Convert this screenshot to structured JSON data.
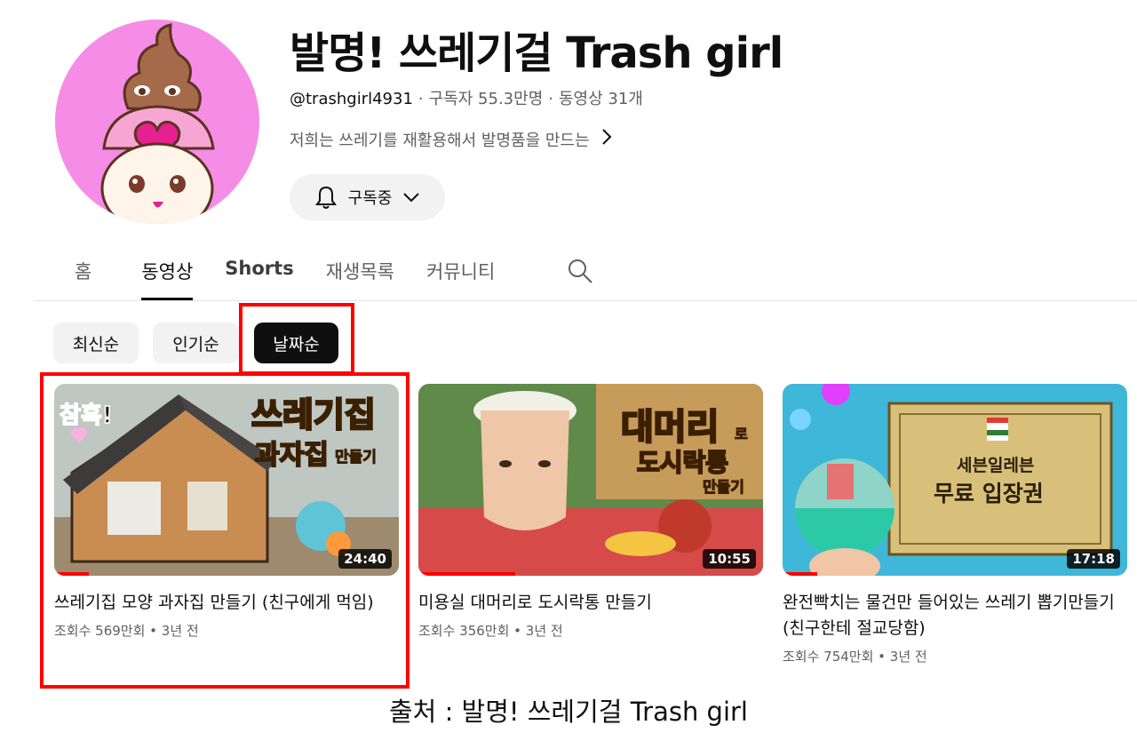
{
  "channel": {
    "title": "발명! 쓰레기걸 Trash girl",
    "handle": "@trashgirl4931",
    "subscribers": "구독자 55.3만명",
    "video_count": "동영상 31개",
    "description": "저희는 쓰레기를 재활용해서 발명품을 만드는",
    "subscribe_label": "구독중"
  },
  "tabs": [
    "홈",
    "동영상",
    "Shorts",
    "재생목록",
    "커뮤니티"
  ],
  "active_tab": "동영상",
  "sort_chips": [
    "최신순",
    "인기순",
    "날짜순"
  ],
  "selected_chip": "날짜순",
  "videos": [
    {
      "thumb_text_1": "참혹!",
      "thumb_text_2": "쓰레기집",
      "thumb_text_3": "과자집",
      "thumb_text_4": "만들기",
      "duration": "24:40",
      "watched_fraction": 0.1,
      "title": "쓰레기집 모양 과자집 만들기 (친구에게 먹임)",
      "views": "조회수 569만회",
      "age": "3년 전"
    },
    {
      "thumb_text_1": "대머리",
      "thumb_text_2": "로",
      "thumb_text_3": "도시락통",
      "thumb_text_4": "만들기",
      "duration": "10:55",
      "watched_fraction": 0.28,
      "title": "미용실 대머리로 도시락통 만들기",
      "views": "조회수 356만회",
      "age": "3년 전"
    },
    {
      "thumb_text_1": "세븐일레븐",
      "thumb_text_2": "무료 입장권",
      "duration": "17:18",
      "watched_fraction": 0.1,
      "title": "완전빡치는 물건만 들어있는 쓰레기 뽑기만들기 (친구한테 절교당함)",
      "views": "조회수 754만회",
      "age": "3년 전"
    }
  ],
  "source_caption": "출처 : 발명! 쓰레기걸 Trash girl",
  "colors": {
    "highlight": "#ff0000",
    "avatar_bg": "#f58ce6",
    "chip_selected": "#0f0f0f"
  }
}
